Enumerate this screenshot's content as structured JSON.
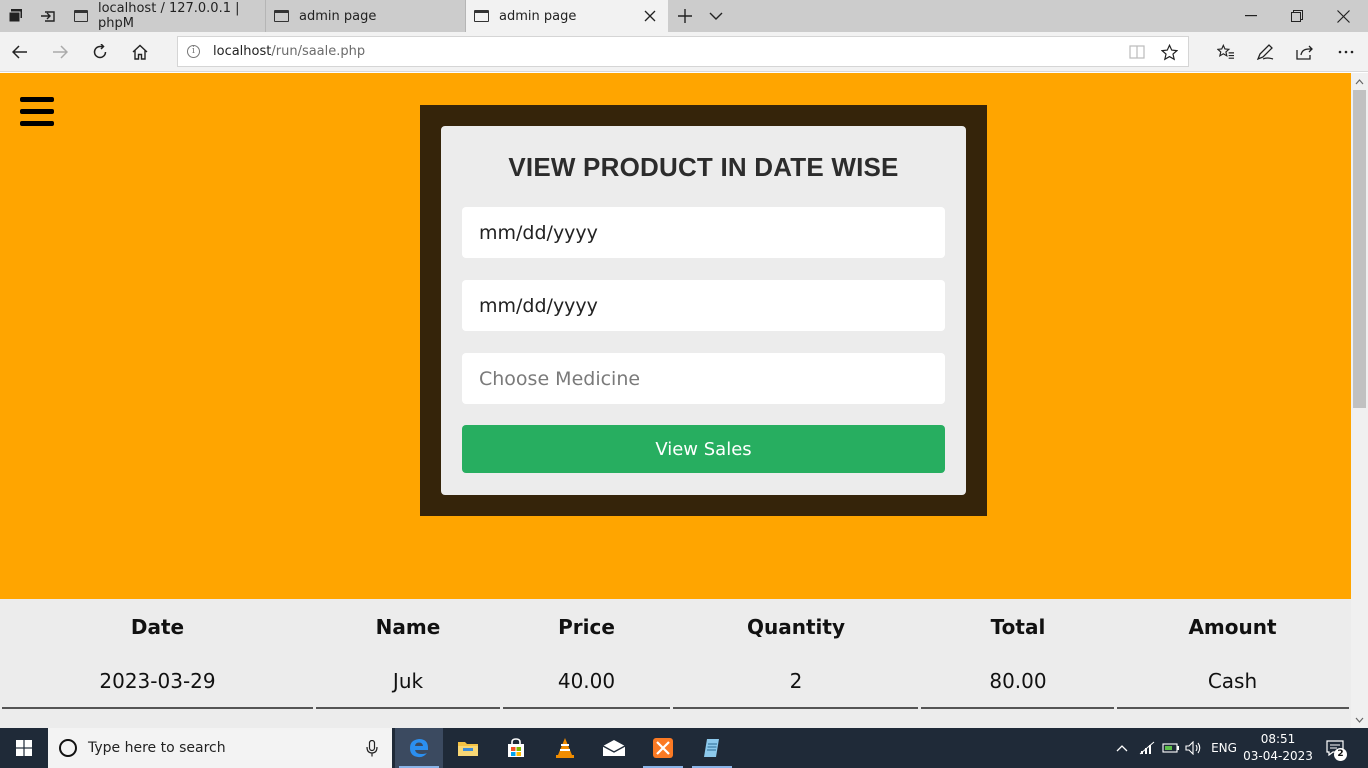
{
  "browser": {
    "tabs": [
      {
        "title": "localhost / 127.0.0.1 | phpM",
        "active": false
      },
      {
        "title": "admin page",
        "active": false
      },
      {
        "title": "admin page",
        "active": true
      }
    ],
    "address": {
      "host": "localhost",
      "path": "/run/saale.php"
    }
  },
  "page": {
    "form": {
      "title": "VIEW PRODUCT IN DATE WISE",
      "date_from": "mm/dd/yyyy",
      "date_to": "mm/dd/yyyy",
      "medicine_placeholder": "Choose Medicine",
      "submit_label": "View Sales"
    },
    "table": {
      "headers": [
        "Date",
        "Name",
        "Price",
        "Quantity",
        "Total",
        "Amount"
      ],
      "rows": [
        [
          "2023-03-29",
          "Juk",
          "40.00",
          "2",
          "80.00",
          "Cash"
        ]
      ]
    },
    "colors": {
      "hero_bg": "#ffa500",
      "frame_bg": "#35240a",
      "button_bg": "#27ae60"
    }
  },
  "taskbar": {
    "search_placeholder": "Type here to search",
    "language": "ENG",
    "time": "08:51",
    "date": "03-04-2023",
    "notification_count": "2",
    "apps": [
      "edge-icon",
      "file-explorer-icon",
      "store-icon",
      "vlc-icon",
      "mail-icon",
      "xampp-icon",
      "notepad-icon"
    ]
  }
}
